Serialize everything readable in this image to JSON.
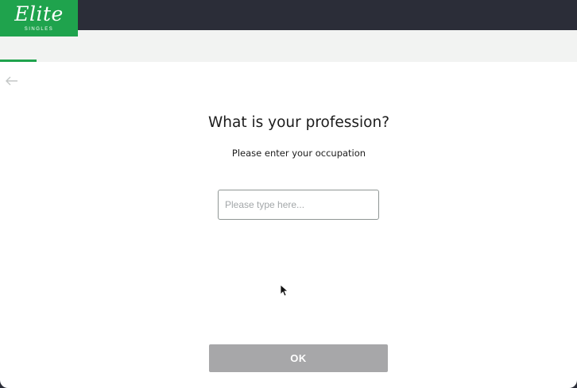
{
  "brand": {
    "name": "Elite",
    "sub": "SINGLES",
    "color": "#1fa34d"
  },
  "progress": {
    "fraction": 0.063
  },
  "back": {
    "icon": "arrow-left-icon"
  },
  "question": {
    "title": "What is your profession?",
    "subtitle": "Please enter your occupation"
  },
  "input": {
    "value": "",
    "placeholder": "Please type here..."
  },
  "ok_button": {
    "label": "OK"
  }
}
